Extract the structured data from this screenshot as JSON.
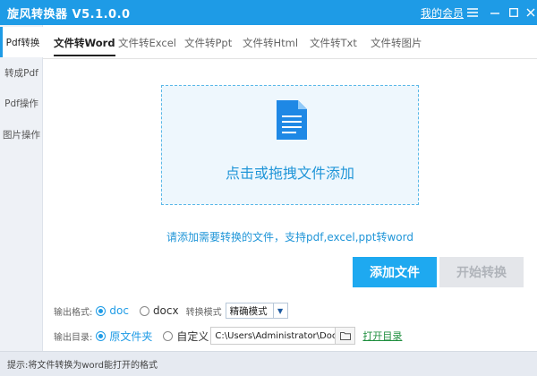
{
  "window": {
    "title": "旋风转换器 V5.1.0.0",
    "member_link": "我的会员"
  },
  "sidebar": {
    "items": [
      {
        "label": "Pdf转换",
        "active": true
      },
      {
        "label": "转成Pdf",
        "active": false
      },
      {
        "label": "Pdf操作",
        "active": false
      },
      {
        "label": "图片操作",
        "active": false
      }
    ]
  },
  "tabs": [
    {
      "label": "文件转Word",
      "active": true
    },
    {
      "label": "文件转Excel",
      "active": false
    },
    {
      "label": "文件转Ppt",
      "active": false
    },
    {
      "label": "文件转Html",
      "active": false
    },
    {
      "label": "文件转Txt",
      "active": false
    },
    {
      "label": "文件转图片",
      "active": false
    }
  ],
  "dropzone": {
    "text": "点击或拖拽文件添加",
    "icon": "document-icon"
  },
  "hint": "请添加需要转换的文件，支持pdf,excel,ppt转word",
  "buttons": {
    "add": "添加文件",
    "start": "开始转换"
  },
  "output_format": {
    "label": "输出格式:",
    "options": [
      "doc",
      "docx"
    ],
    "selected": "doc",
    "mode_label": "转换模式",
    "mode_value": "精确模式"
  },
  "output_dir": {
    "label": "输出目录:",
    "options": [
      "原文件夹",
      "自定义"
    ],
    "selected": "原文件夹",
    "path": "C:\\Users\\Administrator\\Documents",
    "open_label": "打开目录"
  },
  "status": "提示:将文件转换为word能打开的格式",
  "colors": {
    "accent": "#1e9be6",
    "link_green": "#1e8e3e"
  }
}
